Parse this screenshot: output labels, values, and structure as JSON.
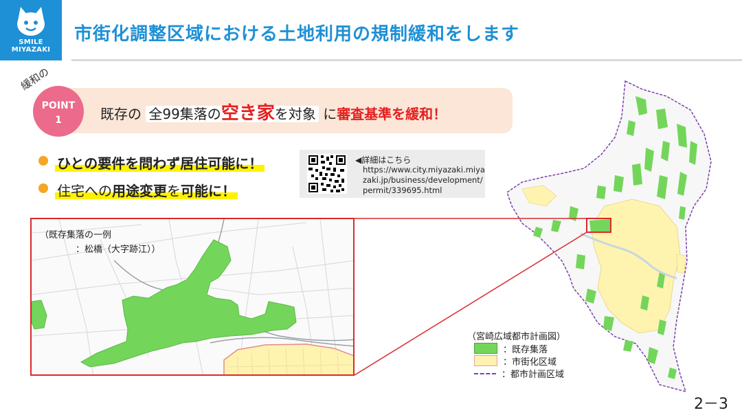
{
  "header": {
    "logo_text_line1": "SMILE",
    "logo_text_line2": "MIYAZAKI",
    "title": "市街化調整区域における土地利用の規制緩和をします"
  },
  "point": {
    "tag": "緩和の",
    "label": "POINT",
    "number": "1",
    "text_part1": "既存の",
    "text_box": "全99集落の",
    "text_highlight": "空き家",
    "text_part2": "を対象",
    "text_part3": "に",
    "text_emphasis": "審査基準を緩和！"
  },
  "bullets": [
    {
      "text": "ひとの要件を問わず居住可能に！"
    },
    {
      "part1": "住宅への",
      "bold1": "用途変更",
      "part2": "を",
      "bold2": "可能に！"
    }
  ],
  "qr": {
    "label": "◀詳細はこちら",
    "url": "https://www.city.miyazaki.miyazaki.jp/business/development/permit/339695.html"
  },
  "inset": {
    "caption_line1": "（既存集落の一例",
    "caption_line2": "：松橋（大字跡江））"
  },
  "legend": {
    "title": "（宮崎広域都市計画図）",
    "items": [
      {
        "label": "：既存集落",
        "color": "#73d65a"
      },
      {
        "label": "：市街化区域",
        "color": "#fff3b0"
      },
      {
        "label": "：都市計画区域",
        "color": "#7b3fa8"
      }
    ]
  },
  "page_number": "2－3",
  "colors": {
    "accent_blue": "#1e90d6",
    "point_pink": "#ec6a8c",
    "emphasis_red": "#e41f1f",
    "settlement_green": "#73d65a",
    "urban_yellow": "#fff3b0",
    "boundary_purple": "#7b3fa8"
  }
}
